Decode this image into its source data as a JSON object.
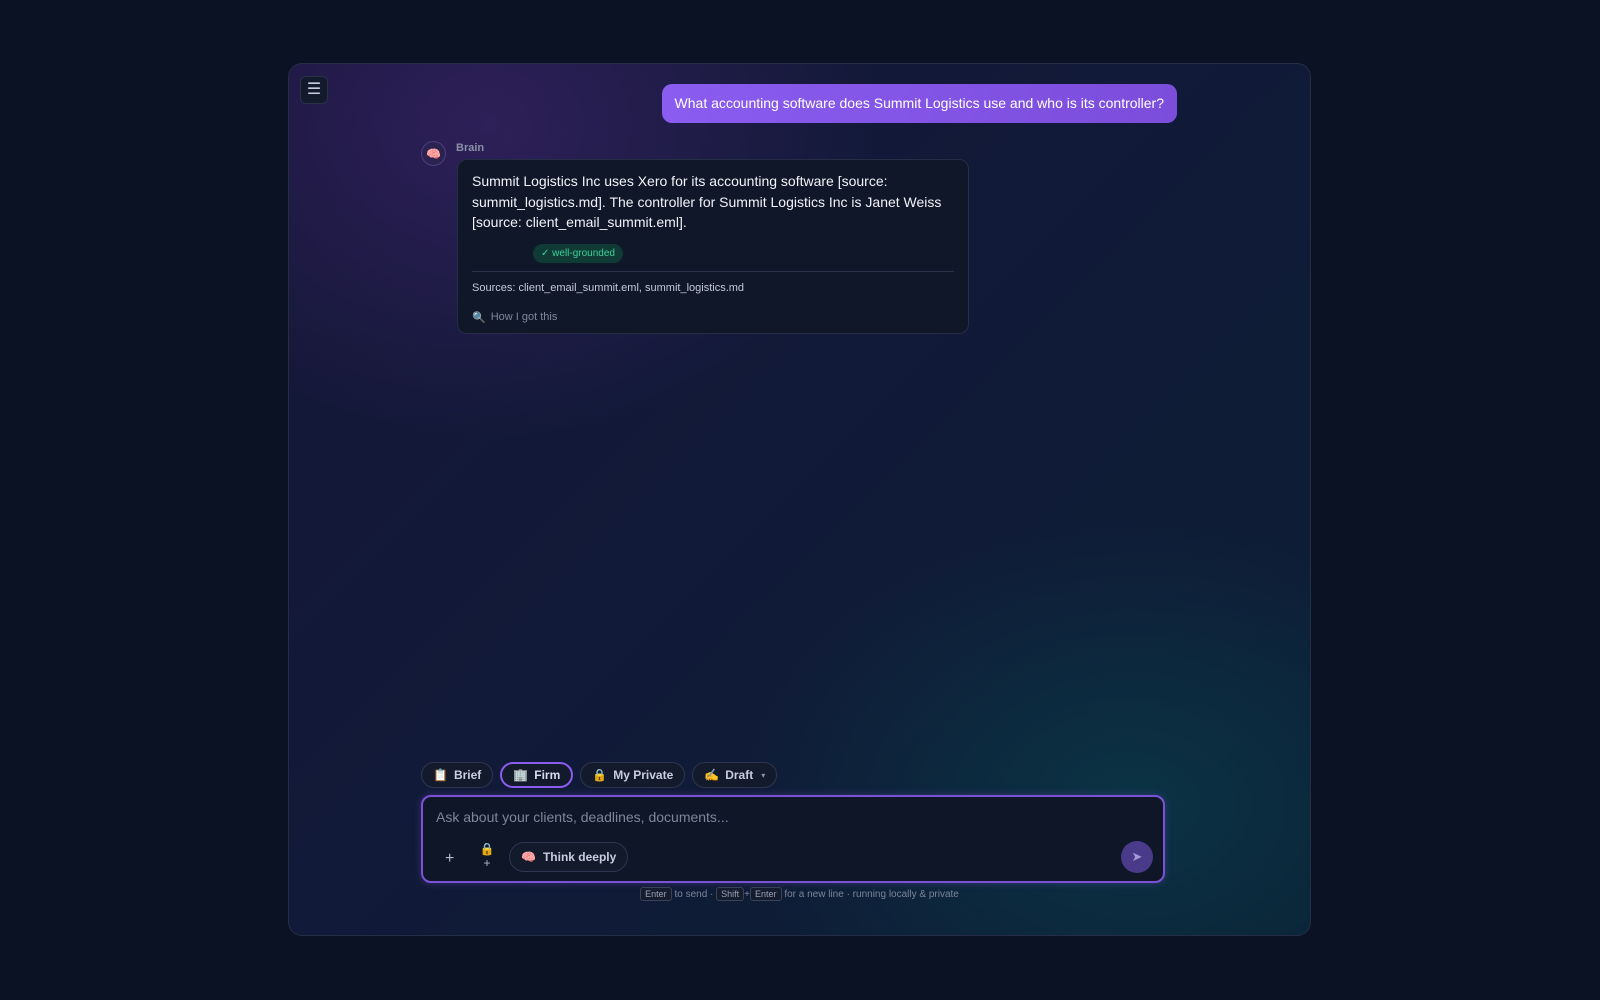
{
  "header": {
    "menu_icon": "☰"
  },
  "conversation": {
    "user_message": "What accounting software does Summit Logistics use and who is its controller?",
    "assistant": {
      "avatar_icon": "🧠",
      "name": "Brain",
      "answer": "Summit Logistics Inc uses Xero for its accounting software [source: summit_logistics.md]. The controller for Summit Logistics Inc is Janet Weiss [source: client_email_summit.eml].",
      "badge": "✓ well-grounded",
      "sources": "Sources: client_email_summit.eml, summit_logistics.md",
      "how_icon": "🔍",
      "how_label": "How I got this"
    }
  },
  "modes": [
    {
      "icon": "📋",
      "label": "Brief"
    },
    {
      "icon": "🏢",
      "label": "Firm",
      "active": true
    },
    {
      "icon": "🔒",
      "label": "My Private"
    },
    {
      "icon": "✍️",
      "label": "Draft",
      "dropdown": "▾"
    }
  ],
  "composer": {
    "placeholder": "Ask about your clients, deadlines, documents...",
    "attach_icon": "+",
    "private_attach_icon": "🔒",
    "private_attach_plus": "+",
    "think_icon": "🧠",
    "think_label": "Think deeply",
    "send_icon": "➤"
  },
  "hint": {
    "key_enter": "Enter",
    "to_send": "to send ·",
    "key_shift": "Shift",
    "plus": "+",
    "rest": "for a new line · running locally & private"
  },
  "colors": {
    "accent": "#8a5cf0",
    "background": "#0b1224",
    "grounded": "#3fd19a"
  }
}
